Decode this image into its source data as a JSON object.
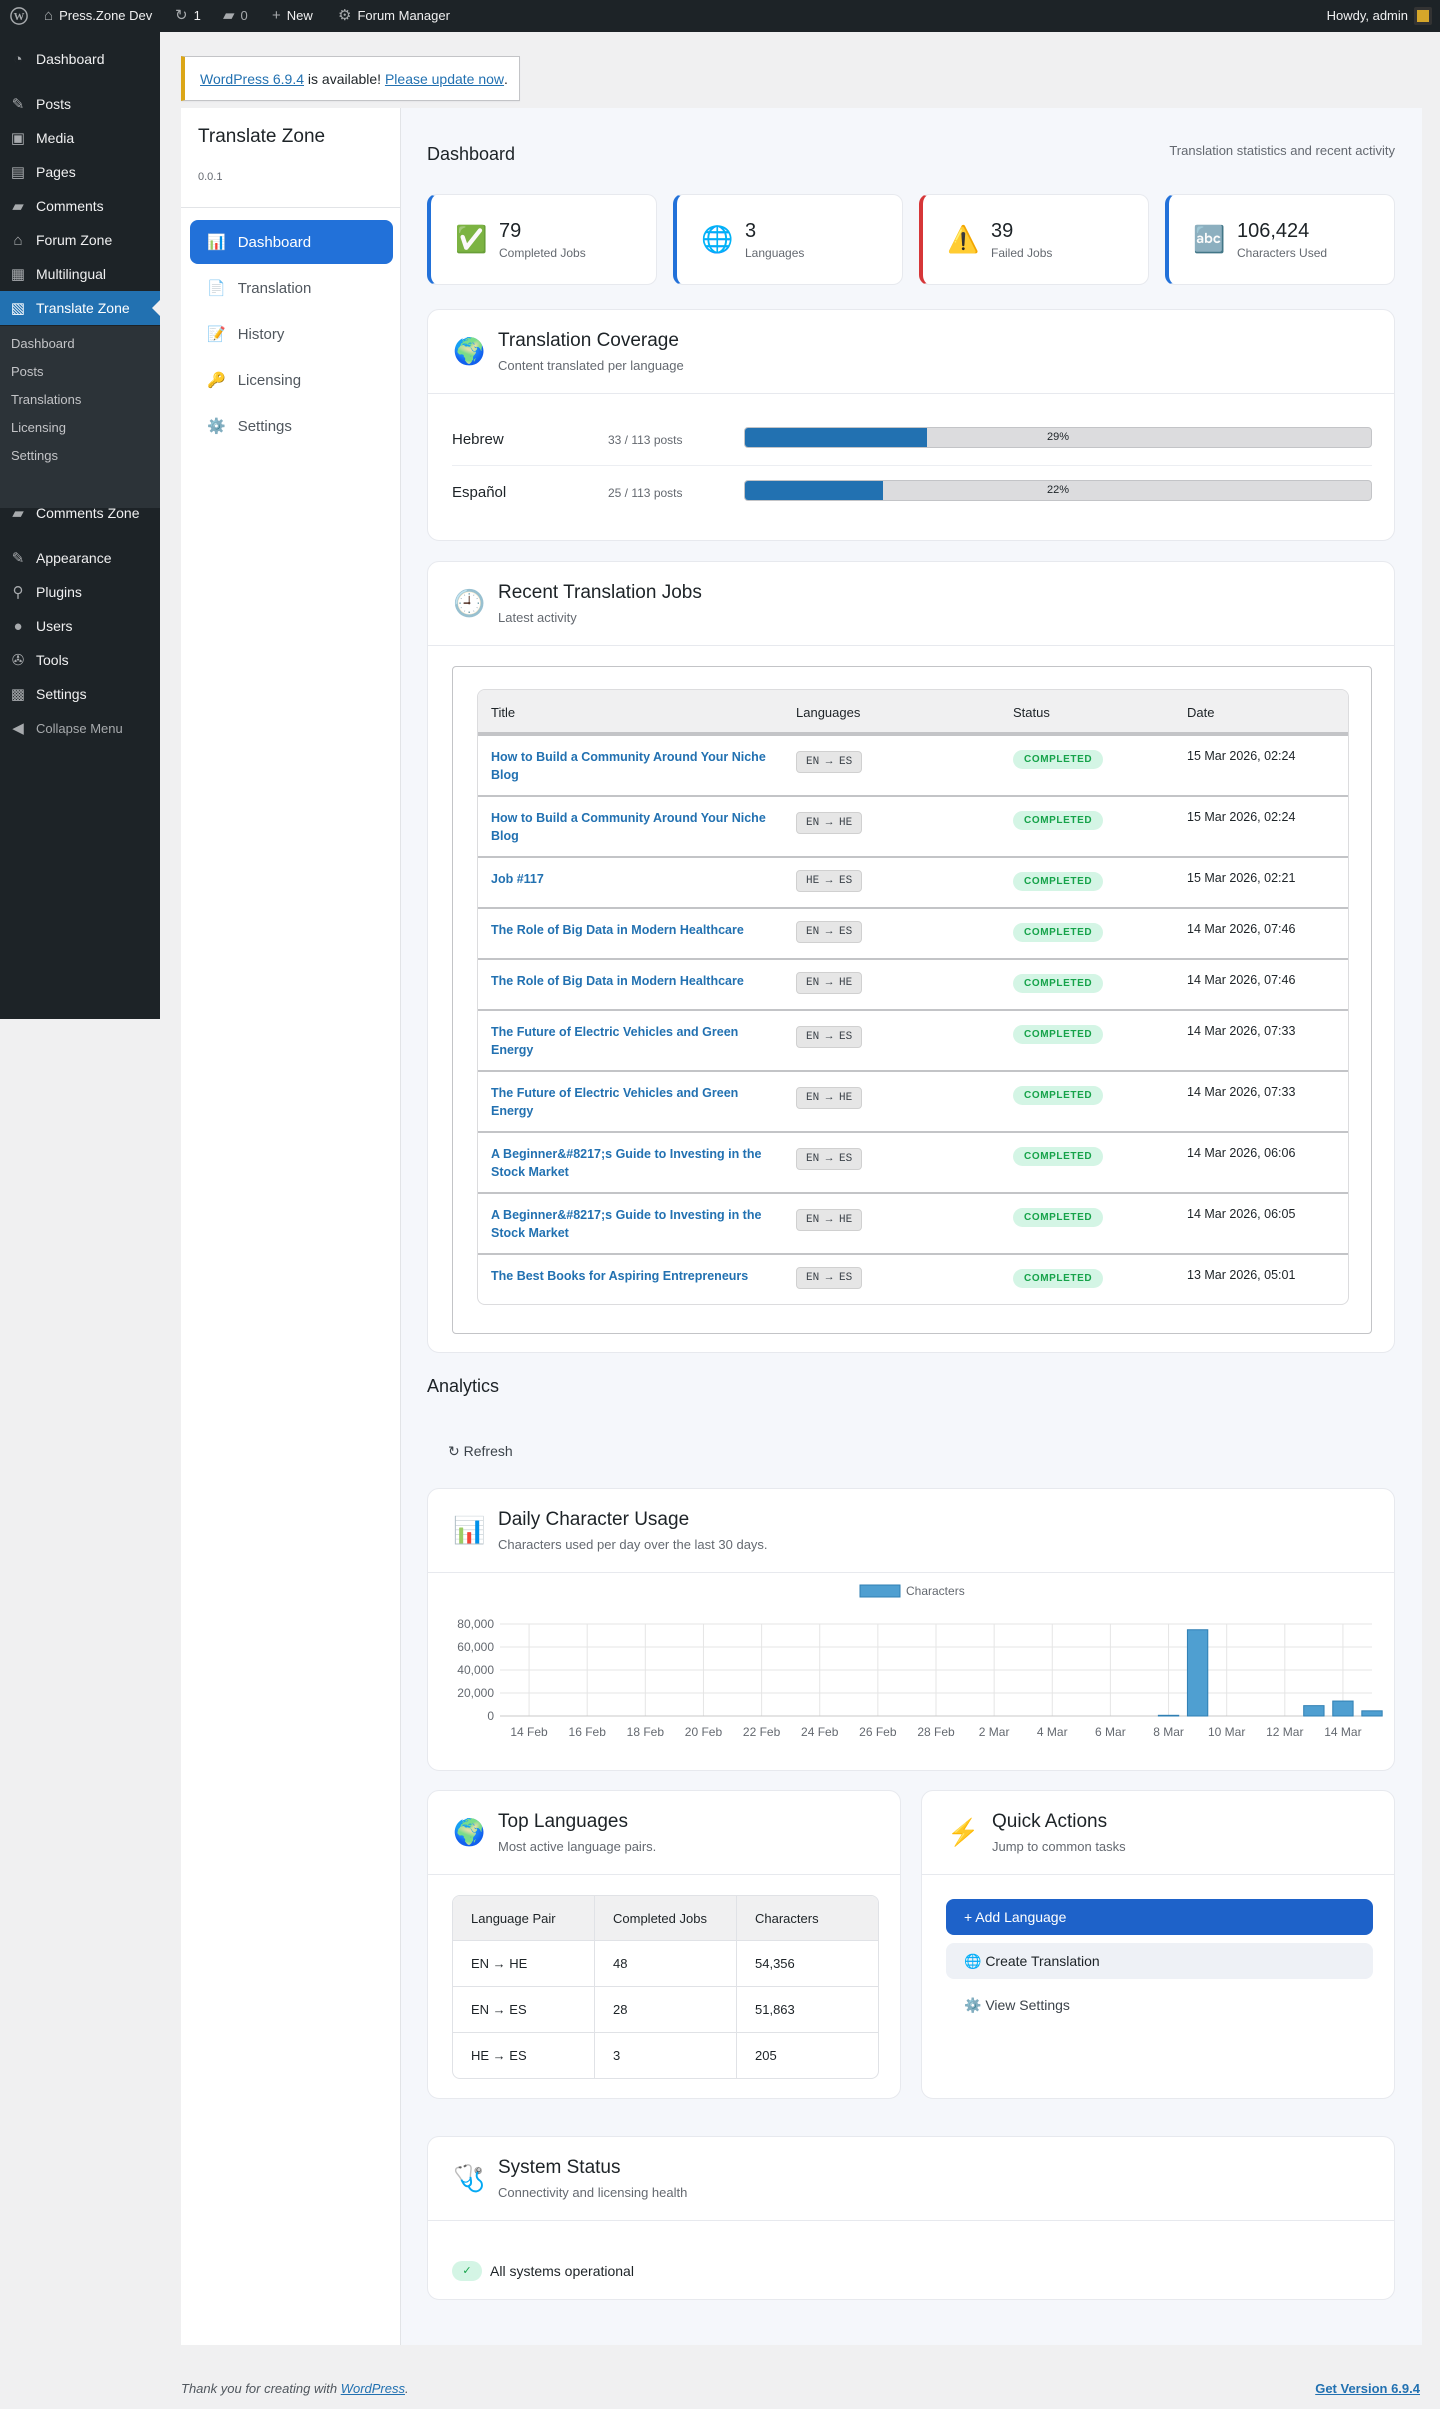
{
  "adminbar": {
    "site_name": "Press.Zone Dev",
    "updates_count": "1",
    "comments_count": "0",
    "new_label": "New",
    "forum_manager": "Forum Manager",
    "greeting": "Howdy, admin"
  },
  "adminmenu": {
    "items": [
      {
        "label": "Dashboard",
        "icon": "dashboard-icon"
      },
      {
        "label": "Posts",
        "icon": "pin-icon"
      },
      {
        "label": "Media",
        "icon": "media-icon"
      },
      {
        "label": "Pages",
        "icon": "page-icon"
      },
      {
        "label": "Comments",
        "icon": "comment-icon"
      },
      {
        "label": "Forum Zone",
        "icon": "forum-icon"
      },
      {
        "label": "Multilingual",
        "icon": "multilingual-icon"
      },
      {
        "label": "Translate Zone",
        "icon": "translate-icon"
      },
      {
        "label": "Comments Zone",
        "icon": "comment-icon"
      },
      {
        "label": "Appearance",
        "icon": "brush-icon"
      },
      {
        "label": "Plugins",
        "icon": "plugin-icon"
      },
      {
        "label": "Users",
        "icon": "user-icon"
      },
      {
        "label": "Tools",
        "icon": "wrench-icon"
      },
      {
        "label": "Settings",
        "icon": "settings-icon"
      }
    ],
    "submenu": [
      "Dashboard",
      "Posts",
      "Translations",
      "Licensing",
      "Settings"
    ],
    "collapse": "Collapse Menu"
  },
  "notice": {
    "link1": "WordPress 6.9.4",
    "middle": " is available! ",
    "link2": "Please update now",
    "end": "."
  },
  "plugin": {
    "title": "Translate Zone",
    "version": "0.0.1",
    "nav": [
      {
        "label": "Dashboard",
        "icon": "📊"
      },
      {
        "label": "Translation",
        "icon": "📄"
      },
      {
        "label": "History",
        "icon": "📝"
      },
      {
        "label": "Licensing",
        "icon": "🔑"
      },
      {
        "label": "Settings",
        "icon": "⚙️"
      }
    ]
  },
  "dashboard": {
    "title": "Dashboard",
    "tagline": "Translation statistics and recent activity",
    "stats": [
      {
        "value": "79",
        "label": "Completed Jobs",
        "icon": "✅",
        "accent": "#2271d9"
      },
      {
        "value": "3",
        "label": "Languages",
        "icon": "🌐",
        "accent": "#2271d9"
      },
      {
        "value": "39",
        "label": "Failed Jobs",
        "icon": "⚠️",
        "accent": "#d63638"
      },
      {
        "value": "106,424",
        "label": "Characters Used",
        "icon": "🔤",
        "accent": "#2271d9"
      }
    ]
  },
  "coverage": {
    "title": "Translation Coverage",
    "subtitle": "Content translated per language",
    "icon": "🌍",
    "rows": [
      {
        "language": "Hebrew",
        "count": "33 / 113 posts",
        "percent": 29,
        "percent_label": "29%"
      },
      {
        "language": "Español",
        "count": "25 / 113 posts",
        "percent": 22,
        "percent_label": "22%"
      }
    ]
  },
  "jobs": {
    "title": "Recent Translation Jobs",
    "subtitle": "Latest activity",
    "icon": "🕘",
    "columns": [
      "Title",
      "Languages",
      "Status",
      "Date"
    ],
    "rows": [
      {
        "title": "How to Build a Community Around Your Niche Blog",
        "langs": "EN → ES",
        "status": "COMPLETED",
        "date": "15 Mar 2026, 02:24"
      },
      {
        "title": "How to Build a Community Around Your Niche Blog",
        "langs": "EN → HE",
        "status": "COMPLETED",
        "date": "15 Mar 2026, 02:24"
      },
      {
        "title": "Job #117",
        "langs": "HE → ES",
        "status": "COMPLETED",
        "date": "15 Mar 2026, 02:21"
      },
      {
        "title": "The Role of Big Data in Modern Healthcare",
        "langs": "EN → ES",
        "status": "COMPLETED",
        "date": "14 Mar 2026, 07:46"
      },
      {
        "title": "The Role of Big Data in Modern Healthcare",
        "langs": "EN → HE",
        "status": "COMPLETED",
        "date": "14 Mar 2026, 07:46"
      },
      {
        "title": "The Future of Electric Vehicles and Green Energy",
        "langs": "EN → ES",
        "status": "COMPLETED",
        "date": "14 Mar 2026, 07:33"
      },
      {
        "title": "The Future of Electric Vehicles and Green Energy",
        "langs": "EN → HE",
        "status": "COMPLETED",
        "date": "14 Mar 2026, 07:33"
      },
      {
        "title": "A Beginner&#8217;s Guide to Investing in the Stock Market",
        "langs": "EN → ES",
        "status": "COMPLETED",
        "date": "14 Mar 2026, 06:06"
      },
      {
        "title": "A Beginner&#8217;s Guide to Investing in the Stock Market",
        "langs": "EN → HE",
        "status": "COMPLETED",
        "date": "14 Mar 2026, 06:05"
      },
      {
        "title": "The Best Books for Aspiring Entrepreneurs",
        "langs": "EN → ES",
        "status": "COMPLETED",
        "date": "13 Mar 2026, 05:01"
      }
    ]
  },
  "analytics": {
    "title": "Analytics",
    "refresh": "↻ Refresh",
    "usage_title": "Daily Character Usage",
    "usage_subtitle": "Characters used per day over the last 30 days.",
    "usage_icon": "📊"
  },
  "chart_data": {
    "type": "bar",
    "title": "",
    "xlabel": "",
    "ylabel": "",
    "legend_position": "top",
    "grid": true,
    "bar_color": "#4f9fd1",
    "x_tick_labels": [
      "14 Feb",
      "16 Feb",
      "18 Feb",
      "20 Feb",
      "22 Feb",
      "24 Feb",
      "26 Feb",
      "28 Feb",
      "2 Mar",
      "4 Mar",
      "6 Mar",
      "8 Mar",
      "10 Mar",
      "12 Mar",
      "14 Mar"
    ],
    "y_tick_labels": [
      "80,000",
      "60,000",
      "40,000",
      "20,000",
      "0"
    ],
    "ylim": [
      0,
      80000
    ],
    "categories": [
      "13 Feb",
      "14 Feb",
      "15 Feb",
      "16 Feb",
      "17 Feb",
      "18 Feb",
      "19 Feb",
      "20 Feb",
      "21 Feb",
      "22 Feb",
      "23 Feb",
      "24 Feb",
      "25 Feb",
      "26 Feb",
      "27 Feb",
      "28 Feb",
      "1 Mar",
      "2 Mar",
      "3 Mar",
      "4 Mar",
      "5 Mar",
      "6 Mar",
      "7 Mar",
      "8 Mar",
      "9 Mar",
      "10 Mar",
      "11 Mar",
      "12 Mar",
      "13 Mar",
      "14 Mar",
      "15 Mar"
    ],
    "series": [
      {
        "name": "Characters",
        "values": [
          0,
          0,
          0,
          0,
          0,
          0,
          0,
          0,
          0,
          0,
          0,
          0,
          0,
          0,
          0,
          0,
          0,
          0,
          0,
          0,
          0,
          0,
          0,
          600,
          75000,
          0,
          0,
          0,
          9000,
          13000,
          4500
        ]
      }
    ]
  },
  "top_languages": {
    "title": "Top Languages",
    "subtitle": "Most active language pairs.",
    "icon": "🌍",
    "columns": [
      "Language Pair",
      "Completed Jobs",
      "Characters"
    ],
    "rows": [
      [
        "EN → HE",
        "48",
        "54,356"
      ],
      [
        "EN → ES",
        "28",
        "51,863"
      ],
      [
        "HE → ES",
        "3",
        "205"
      ]
    ]
  },
  "quick_actions": {
    "title": "Quick Actions",
    "subtitle": "Jump to common tasks",
    "icon": "⚡",
    "add_language": "+ Add Language",
    "create_translation": "🌐 Create Translation",
    "view_settings": "⚙️ View Settings"
  },
  "system_status": {
    "title": "System Status",
    "subtitle": "Connectivity and licensing health",
    "icon": "🩺",
    "check": "✓",
    "message": "All systems operational"
  },
  "footer": {
    "thanks": "Thank you for creating with ",
    "wordpress": "WordPress",
    "end": ".",
    "version": "Get Version 6.9.4"
  }
}
